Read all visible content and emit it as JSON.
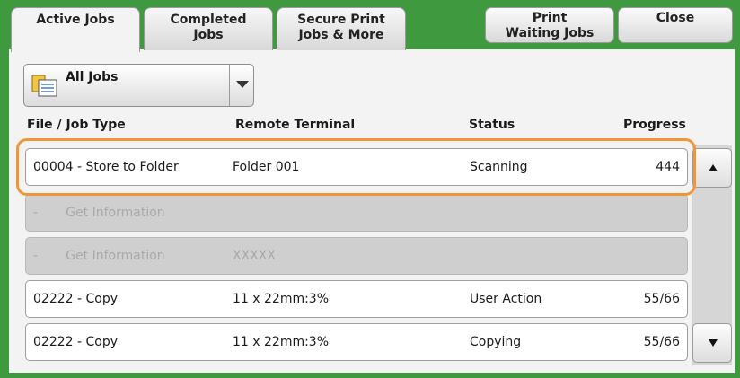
{
  "tabs": [
    {
      "line1": "Active Jobs",
      "line2": ""
    },
    {
      "line1": "Completed",
      "line2": "Jobs"
    },
    {
      "line1": "Secure Print",
      "line2": "Jobs & More"
    }
  ],
  "buttons": {
    "print_waiting_line1": "Print",
    "print_waiting_line2": "Waiting Jobs",
    "close": "Close"
  },
  "filter": {
    "selected": "All Jobs",
    "icon": "job-list-icon"
  },
  "columns": {
    "type": "File / Job Type",
    "terminal": "Remote Terminal",
    "status": "Status",
    "progress": "Progress"
  },
  "rows": [
    {
      "type": "00004 - Store to Folder",
      "terminal": "Folder 001",
      "status": "Scanning",
      "progress": "444"
    },
    {
      "type": "-       Get Information",
      "terminal": "",
      "status": "",
      "progress": ""
    },
    {
      "type": "-       Get Information",
      "terminal": "XXXXX",
      "status": "",
      "progress": ""
    },
    {
      "type": "02222 - Copy",
      "terminal": "11 x 22mm:3%",
      "status": "User Action",
      "progress": "55/66"
    },
    {
      "type": "02222 - Copy",
      "terminal": "11 x 22mm:3%",
      "status": "Copying",
      "progress": "55/66"
    }
  ],
  "colors": {
    "background_green": "#3f9a3f",
    "highlight_orange": "#f0963a",
    "disabled_row": "#cfcfcf"
  }
}
